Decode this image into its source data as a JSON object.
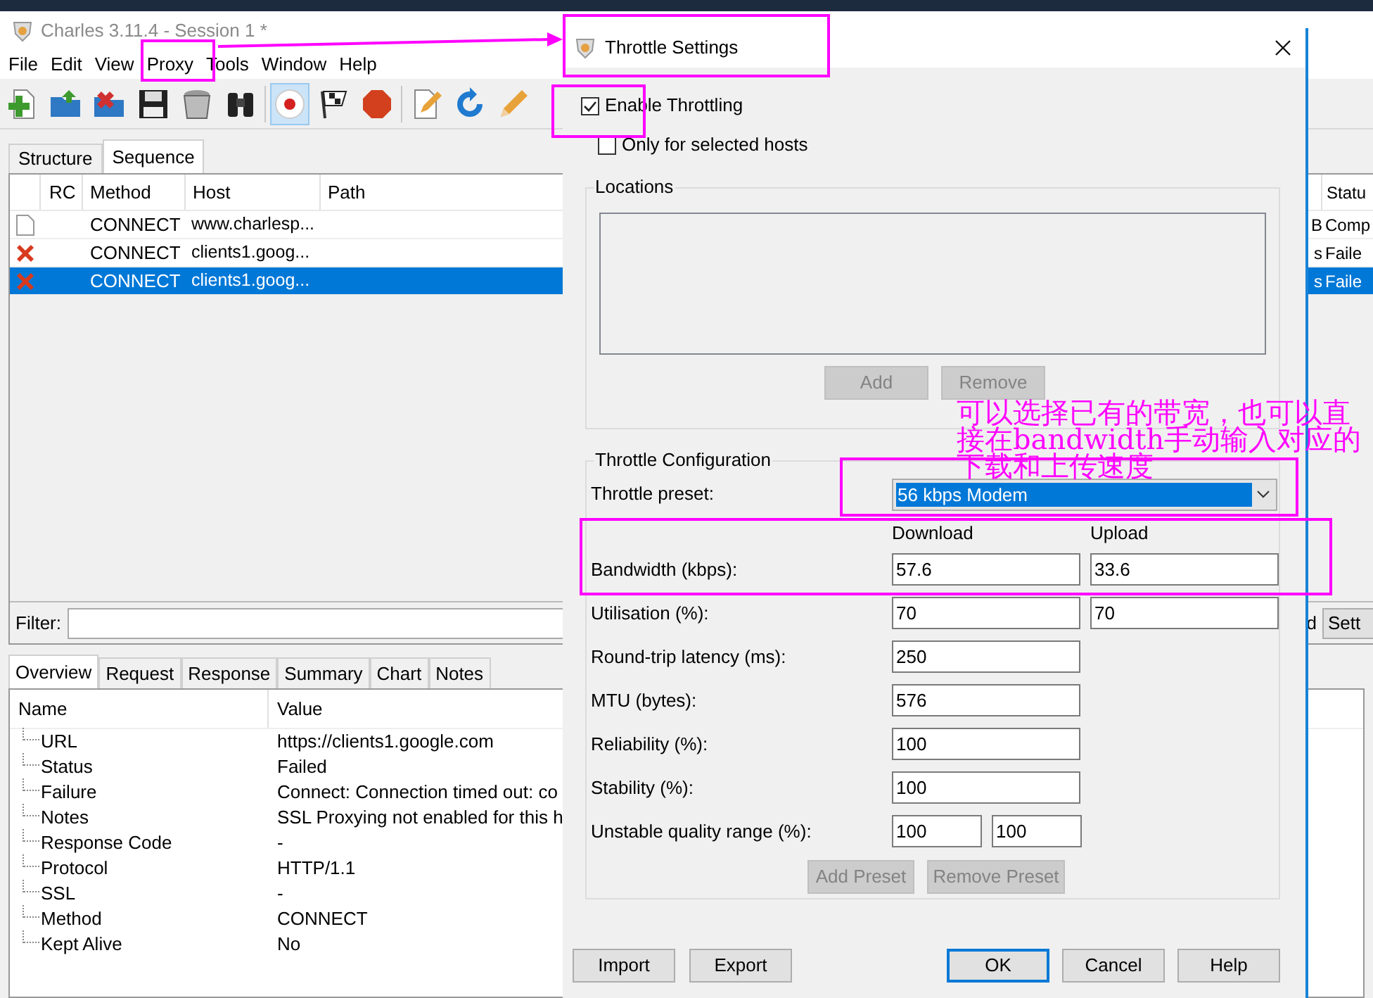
{
  "main_window": {
    "title": "Charles 3.11.4 - Session 1 *",
    "menu": [
      "File",
      "Edit",
      "View",
      "Proxy",
      "Tools",
      "Window",
      "Help"
    ],
    "toolbar": [
      {
        "selected": false
      },
      {
        "selected": false
      },
      {
        "selected": false
      },
      {
        "selected": false
      },
      {
        "selected": false
      },
      {
        "selected": false
      },
      {
        "selected": true
      },
      {
        "selected": false
      },
      {
        "selected": false
      },
      {
        "selected": false
      },
      {
        "selected": false
      },
      {
        "selected": false
      }
    ],
    "session_tabs": [
      {
        "label": "Structure",
        "selected": false
      },
      {
        "label": "Sequence",
        "selected": true
      }
    ],
    "sequence_table": {
      "columns": [
        "RC",
        "Method",
        "Host",
        "Path"
      ],
      "status_column": "Statu",
      "rows": [
        {
          "kind": "document",
          "rc": "",
          "method": "CONNECT",
          "host": "www.charlesp...",
          "size": "B",
          "status": "Comp",
          "selected": false
        },
        {
          "kind": "failed",
          "rc": "",
          "method": "CONNECT",
          "host": "clients1.goog...",
          "size": "s",
          "status": "Faile",
          "selected": false
        },
        {
          "kind": "failed",
          "rc": "",
          "method": "CONNECT",
          "host": "clients1.goog...",
          "size": "s",
          "status": "Faile",
          "selected": true
        }
      ]
    },
    "filter": {
      "label": "Filter:",
      "right_text": "d",
      "settings_button": "Sett"
    },
    "detail_tabs": [
      {
        "label": "Overview",
        "selected": true
      },
      {
        "label": "Request",
        "selected": false
      },
      {
        "label": "Response",
        "selected": false
      },
      {
        "label": "Summary",
        "selected": false
      },
      {
        "label": "Chart",
        "selected": false
      },
      {
        "label": "Notes",
        "selected": false
      }
    ],
    "overview": {
      "columns": [
        "Name",
        "Value"
      ],
      "rows": [
        {
          "name": "URL",
          "value": "https://clients1.google.com"
        },
        {
          "name": "Status",
          "value": "Failed"
        },
        {
          "name": "Failure",
          "value": "Connect: Connection timed out: co"
        },
        {
          "name": "Notes",
          "value": "SSL Proxying not enabled for this h"
        },
        {
          "name": "Response Code",
          "value": "-"
        },
        {
          "name": "Protocol",
          "value": "HTTP/1.1"
        },
        {
          "name": "SSL",
          "value": "-"
        },
        {
          "name": "Method",
          "value": "CONNECT"
        },
        {
          "name": "Kept Alive",
          "value": "No"
        }
      ]
    }
  },
  "dialog": {
    "title": "Throttle Settings",
    "enable_throttling": {
      "label": "Enable Throttling",
      "checked": true
    },
    "only_selected_hosts": {
      "label": "Only for selected hosts",
      "checked": false
    },
    "locations": {
      "title": "Locations",
      "buttons": [
        {
          "label": "Add",
          "disabled": true
        },
        {
          "label": "Remove",
          "disabled": true
        }
      ]
    },
    "configuration": {
      "title": "Throttle Configuration",
      "preset_label": "Throttle preset:",
      "preset_value": "56 kbps Modem",
      "headers": [
        "Download",
        "Upload"
      ],
      "rows": [
        {
          "kind": "pair",
          "label": "Bandwidth (kbps):",
          "values": [
            "57.6",
            "33.6"
          ]
        },
        {
          "kind": "pair",
          "label": "Utilisation (%):",
          "values": [
            "70",
            "70"
          ]
        },
        {
          "kind": "single",
          "label": "Round-trip latency (ms):",
          "values": [
            "250"
          ]
        },
        {
          "kind": "single",
          "label": "MTU (bytes):",
          "values": [
            "576"
          ]
        },
        {
          "kind": "single",
          "label": "Reliability (%):",
          "values": [
            "100"
          ]
        },
        {
          "kind": "single",
          "label": "Stability (%):",
          "values": [
            "100"
          ]
        },
        {
          "kind": "range",
          "label": "Unstable quality range (%):",
          "values": [
            "100",
            "100"
          ]
        }
      ],
      "buttons": [
        {
          "label": "Add Preset",
          "disabled": true
        },
        {
          "label": "Remove Preset",
          "disabled": true
        }
      ]
    },
    "left_buttons": [
      {
        "label": "Import",
        "default": false
      },
      {
        "label": "Export",
        "default": false
      }
    ],
    "right_buttons": [
      {
        "label": "OK",
        "default": true
      },
      {
        "label": "Cancel",
        "default": false
      },
      {
        "label": "Help",
        "default": false
      }
    ]
  },
  "annotation": {
    "text": "可以选择已有的带宽，也可以直接在bandwidth手动输入对应的下载和上传速度"
  }
}
